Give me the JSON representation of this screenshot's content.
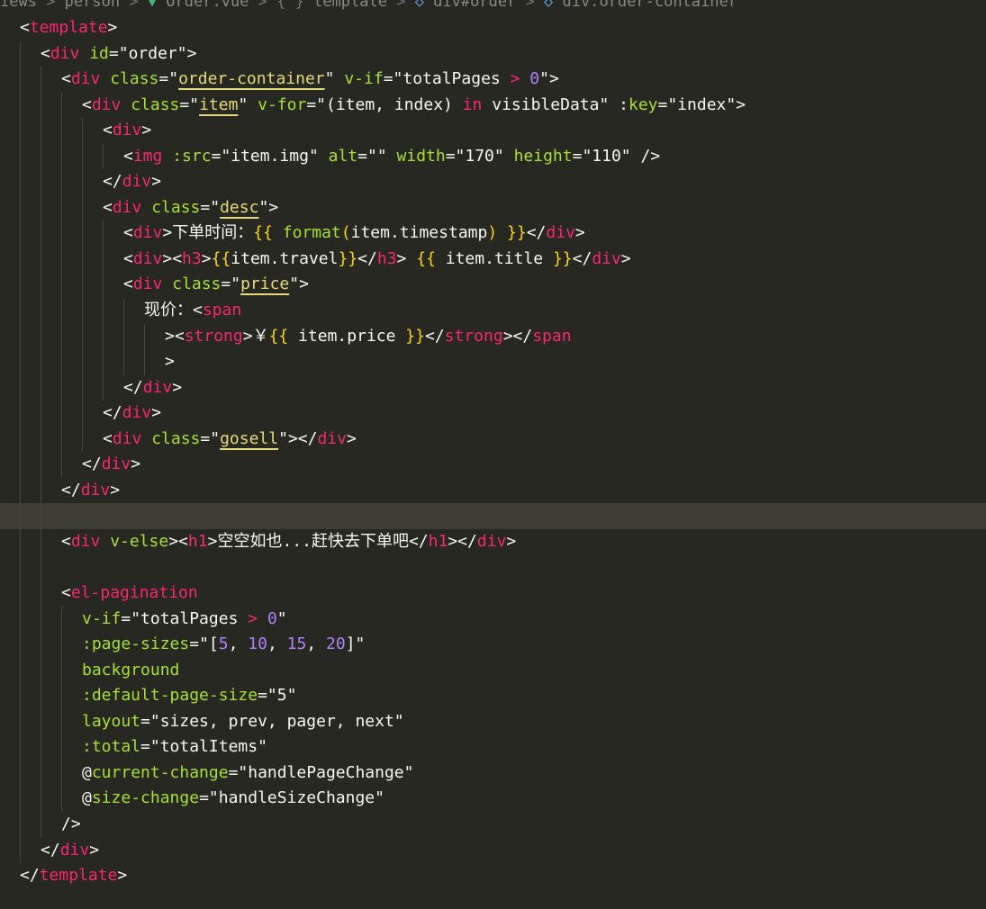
{
  "breadcrumb": [
    {
      "text": "iews",
      "kind": "folder"
    },
    {
      "text": "person",
      "kind": "folder"
    },
    {
      "text": "Order.vue",
      "kind": "vue-file"
    },
    {
      "text": "template",
      "kind": "braces"
    },
    {
      "text": "div#order",
      "kind": "cube"
    },
    {
      "text": "div.order-container",
      "kind": "cube"
    }
  ],
  "current_line": 19,
  "lines": [
    {
      "indent": 0,
      "tokens": [
        [
          "<",
          "p"
        ],
        [
          "template",
          "t"
        ],
        [
          ">",
          "p"
        ]
      ]
    },
    {
      "indent": 1,
      "tokens": [
        [
          "<",
          "p"
        ],
        [
          "div",
          "t"
        ],
        [
          " ",
          "p"
        ],
        [
          "id",
          "a"
        ],
        [
          "=",
          "p"
        ],
        [
          "\"order\"",
          "sw"
        ],
        [
          ">",
          "p"
        ]
      ]
    },
    {
      "indent": 2,
      "tokens": [
        [
          "<",
          "p"
        ],
        [
          "div",
          "t"
        ],
        [
          " ",
          "p"
        ],
        [
          "class",
          "a"
        ],
        [
          "=",
          "p"
        ],
        [
          "\"",
          "sw"
        ],
        [
          "order-container",
          "su"
        ],
        [
          "\"",
          "sw"
        ],
        [
          " ",
          "p"
        ],
        [
          "v-if",
          "a"
        ],
        [
          "=",
          "p"
        ],
        [
          "\"totalPages ",
          "sw"
        ],
        [
          ">",
          "op"
        ],
        [
          " ",
          "p"
        ],
        [
          "0",
          "n"
        ],
        [
          "\"",
          "sw"
        ],
        [
          ">",
          "p"
        ]
      ]
    },
    {
      "indent": 3,
      "tokens": [
        [
          "<",
          "p"
        ],
        [
          "div",
          "t"
        ],
        [
          " ",
          "p"
        ],
        [
          "class",
          "a"
        ],
        [
          "=",
          "p"
        ],
        [
          "\"",
          "sw"
        ],
        [
          "item",
          "su"
        ],
        [
          "\"",
          "sw"
        ],
        [
          " ",
          "p"
        ],
        [
          "v-for",
          "a"
        ],
        [
          "=",
          "p"
        ],
        [
          "\"(item, index) ",
          "sw"
        ],
        [
          "in",
          "op"
        ],
        [
          " visibleData\"",
          "sw"
        ],
        [
          " ",
          "p"
        ],
        [
          ":",
          "p"
        ],
        [
          "key",
          "a"
        ],
        [
          "=",
          "p"
        ],
        [
          "\"index\"",
          "sw"
        ],
        [
          ">",
          "p"
        ]
      ]
    },
    {
      "indent": 4,
      "tokens": [
        [
          "<",
          "p"
        ],
        [
          "div",
          "t"
        ],
        [
          ">",
          "p"
        ]
      ]
    },
    {
      "indent": 5,
      "tokens": [
        [
          "<",
          "p"
        ],
        [
          "img",
          "t"
        ],
        [
          " ",
          "p"
        ],
        [
          ":src",
          "a"
        ],
        [
          "=",
          "p"
        ],
        [
          "\"item.img\"",
          "sw"
        ],
        [
          " ",
          "p"
        ],
        [
          "alt",
          "a"
        ],
        [
          "=",
          "p"
        ],
        [
          "\"\"",
          "sw"
        ],
        [
          " ",
          "p"
        ],
        [
          "width",
          "a"
        ],
        [
          "=",
          "p"
        ],
        [
          "\"170\"",
          "sw"
        ],
        [
          " ",
          "p"
        ],
        [
          "height",
          "a"
        ],
        [
          "=",
          "p"
        ],
        [
          "\"110\"",
          "sw"
        ],
        [
          " />",
          "p"
        ]
      ]
    },
    {
      "indent": 4,
      "tokens": [
        [
          "</",
          "p"
        ],
        [
          "div",
          "t"
        ],
        [
          ">",
          "p"
        ]
      ]
    },
    {
      "indent": 4,
      "tokens": [
        [
          "<",
          "p"
        ],
        [
          "div",
          "t"
        ],
        [
          " ",
          "p"
        ],
        [
          "class",
          "a"
        ],
        [
          "=",
          "p"
        ],
        [
          "\"",
          "sw"
        ],
        [
          "desc",
          "su"
        ],
        [
          "\"",
          "sw"
        ],
        [
          ">",
          "p"
        ]
      ]
    },
    {
      "indent": 5,
      "tokens": [
        [
          "<",
          "p"
        ],
        [
          "div",
          "t"
        ],
        [
          ">",
          "p"
        ],
        [
          "下单时间：",
          "p"
        ],
        [
          "{{",
          "b"
        ],
        [
          " ",
          "p"
        ],
        [
          "format",
          "a"
        ],
        [
          "(",
          "b"
        ],
        [
          "item.timestamp",
          "p"
        ],
        [
          ")",
          "b"
        ],
        [
          " ",
          "p"
        ],
        [
          "}}",
          "b"
        ],
        [
          "</",
          "p"
        ],
        [
          "div",
          "t"
        ],
        [
          ">",
          "p"
        ]
      ]
    },
    {
      "indent": 5,
      "tokens": [
        [
          "<",
          "p"
        ],
        [
          "div",
          "t"
        ],
        [
          "><",
          "p"
        ],
        [
          "h3",
          "t"
        ],
        [
          ">",
          "p"
        ],
        [
          "{{",
          "b"
        ],
        [
          "item.travel",
          "p"
        ],
        [
          "}}",
          "b"
        ],
        [
          "</",
          "p"
        ],
        [
          "h3",
          "t"
        ],
        [
          "> ",
          "p"
        ],
        [
          "{{",
          "b"
        ],
        [
          " item.title ",
          "p"
        ],
        [
          "}}",
          "b"
        ],
        [
          "</",
          "p"
        ],
        [
          "div",
          "t"
        ],
        [
          ">",
          "p"
        ]
      ]
    },
    {
      "indent": 5,
      "tokens": [
        [
          "<",
          "p"
        ],
        [
          "div",
          "t"
        ],
        [
          " ",
          "p"
        ],
        [
          "class",
          "a"
        ],
        [
          "=",
          "p"
        ],
        [
          "\"",
          "sw"
        ],
        [
          "price",
          "su"
        ],
        [
          "\"",
          "sw"
        ],
        [
          ">",
          "p"
        ]
      ]
    },
    {
      "indent": 6,
      "tokens": [
        [
          "现价：",
          "p"
        ],
        [
          "<",
          "p"
        ],
        [
          "span",
          "t"
        ]
      ]
    },
    {
      "indent": 7,
      "tokens": [
        [
          "><",
          "p"
        ],
        [
          "strong",
          "t"
        ],
        [
          ">",
          "p"
        ],
        [
          "￥",
          "p"
        ],
        [
          "{{",
          "b"
        ],
        [
          " item.price ",
          "p"
        ],
        [
          "}}",
          "b"
        ],
        [
          "</",
          "p"
        ],
        [
          "strong",
          "t"
        ],
        [
          "></",
          "p"
        ],
        [
          "span",
          "t"
        ]
      ]
    },
    {
      "indent": 7,
      "tokens": [
        [
          ">",
          "p"
        ]
      ]
    },
    {
      "indent": 5,
      "tokens": [
        [
          "</",
          "p"
        ],
        [
          "div",
          "t"
        ],
        [
          ">",
          "p"
        ]
      ]
    },
    {
      "indent": 4,
      "tokens": [
        [
          "</",
          "p"
        ],
        [
          "div",
          "t"
        ],
        [
          ">",
          "p"
        ]
      ]
    },
    {
      "indent": 4,
      "tokens": [
        [
          "<",
          "p"
        ],
        [
          "div",
          "t"
        ],
        [
          " ",
          "p"
        ],
        [
          "class",
          "a"
        ],
        [
          "=",
          "p"
        ],
        [
          "\"",
          "sw"
        ],
        [
          "gosell",
          "su"
        ],
        [
          "\"",
          "sw"
        ],
        [
          "></",
          "p"
        ],
        [
          "div",
          "t"
        ],
        [
          ">",
          "p"
        ]
      ]
    },
    {
      "indent": 3,
      "tokens": [
        [
          "</",
          "p"
        ],
        [
          "div",
          "t"
        ],
        [
          ">",
          "p"
        ]
      ]
    },
    {
      "indent": 2,
      "tokens": [
        [
          "</",
          "p"
        ],
        [
          "div",
          "t"
        ],
        [
          ">",
          "p"
        ]
      ]
    },
    {
      "indent": 2,
      "tokens": []
    },
    {
      "indent": 2,
      "tokens": [
        [
          "<",
          "p"
        ],
        [
          "div",
          "t"
        ],
        [
          " ",
          "p"
        ],
        [
          "v-else",
          "a"
        ],
        [
          "><",
          "p"
        ],
        [
          "h1",
          "t"
        ],
        [
          ">",
          "p"
        ],
        [
          "空空如也...赶快去下单吧",
          "p"
        ],
        [
          "</",
          "p"
        ],
        [
          "h1",
          "t"
        ],
        [
          "></",
          "p"
        ],
        [
          "div",
          "t"
        ],
        [
          ">",
          "p"
        ]
      ]
    },
    {
      "indent": 2,
      "tokens": []
    },
    {
      "indent": 2,
      "tokens": [
        [
          "<",
          "p"
        ],
        [
          "el-pagination",
          "t"
        ]
      ]
    },
    {
      "indent": 3,
      "tokens": [
        [
          "v-if",
          "a"
        ],
        [
          "=",
          "p"
        ],
        [
          "\"totalPages ",
          "sw"
        ],
        [
          ">",
          "op"
        ],
        [
          " ",
          "p"
        ],
        [
          "0",
          "n"
        ],
        [
          "\"",
          "sw"
        ]
      ]
    },
    {
      "indent": 3,
      "tokens": [
        [
          ":page-sizes",
          "a"
        ],
        [
          "=",
          "p"
        ],
        [
          "\"[",
          "sw"
        ],
        [
          "5",
          "n"
        ],
        [
          ", ",
          "sw"
        ],
        [
          "10",
          "n"
        ],
        [
          ", ",
          "sw"
        ],
        [
          "15",
          "n"
        ],
        [
          ", ",
          "sw"
        ],
        [
          "20",
          "n"
        ],
        [
          "]\"",
          "sw"
        ]
      ]
    },
    {
      "indent": 3,
      "tokens": [
        [
          "background",
          "a"
        ]
      ]
    },
    {
      "indent": 3,
      "tokens": [
        [
          ":default-page-size",
          "a"
        ],
        [
          "=",
          "p"
        ],
        [
          "\"5\"",
          "sw"
        ]
      ]
    },
    {
      "indent": 3,
      "tokens": [
        [
          "layout",
          "a"
        ],
        [
          "=",
          "p"
        ],
        [
          "\"sizes, prev, pager, next\"",
          "sw"
        ]
      ]
    },
    {
      "indent": 3,
      "tokens": [
        [
          ":total",
          "a"
        ],
        [
          "=",
          "p"
        ],
        [
          "\"totalItems\"",
          "sw"
        ]
      ]
    },
    {
      "indent": 3,
      "tokens": [
        [
          "@",
          "p"
        ],
        [
          "current-change",
          "a"
        ],
        [
          "=",
          "p"
        ],
        [
          "\"handlePageChange\"",
          "sw"
        ]
      ]
    },
    {
      "indent": 3,
      "tokens": [
        [
          "@",
          "p"
        ],
        [
          "size-change",
          "a"
        ],
        [
          "=",
          "p"
        ],
        [
          "\"handleSizeChange\"",
          "sw"
        ]
      ]
    },
    {
      "indent": 2,
      "tokens": [
        [
          "/>",
          "p"
        ]
      ]
    },
    {
      "indent": 1,
      "tokens": [
        [
          "</",
          "p"
        ],
        [
          "div",
          "t"
        ],
        [
          ">",
          "p"
        ]
      ]
    },
    {
      "indent": 0,
      "tokens": [
        [
          "</",
          "p"
        ],
        [
          "template",
          "t"
        ],
        [
          ">",
          "p"
        ]
      ]
    }
  ],
  "colors": {
    "background": "#272822",
    "current_line": "#3e3d32",
    "tag": "#f92672",
    "attribute": "#a6e22e",
    "string": "#f8f8f2",
    "number": "#ae81ff",
    "brace": "#ffd700",
    "indent_guide": "#464741"
  }
}
